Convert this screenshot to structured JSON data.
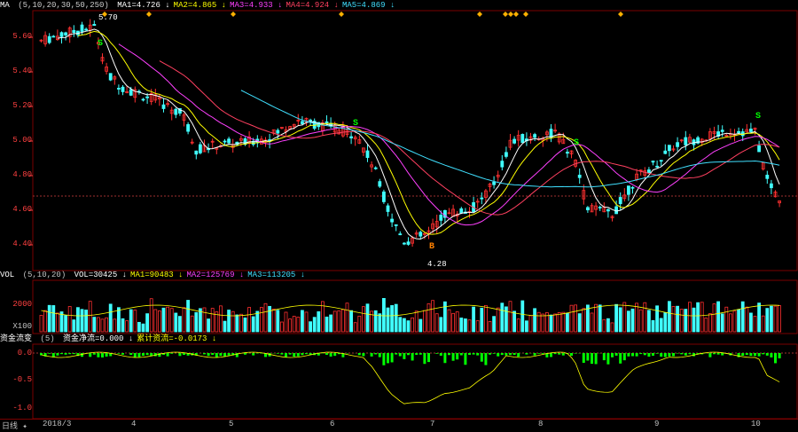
{
  "ma_header": {
    "label": "MA",
    "params": "(5,10,20,30,50,250)",
    "items": [
      {
        "text": "MA1=4.726",
        "color": "#ffffff"
      },
      {
        "text": "MA2=4.865",
        "color": "#ffff00"
      },
      {
        "text": "MA3=4.933",
        "color": "#ff40ff"
      },
      {
        "text": "MA4=4.924",
        "color": "#ff4060"
      },
      {
        "text": "MA5=4.869",
        "color": "#40e0ff"
      }
    ]
  },
  "price_axis": [
    "5.60",
    "5.40",
    "5.20",
    "5.00",
    "4.80",
    "4.60",
    "4.40"
  ],
  "annotations": {
    "high": "5.70",
    "low": "4.28",
    "signal_s": "S",
    "signal_b": "B"
  },
  "vol_header": {
    "label": "VOL",
    "params": "(5,10,20)",
    "items": [
      {
        "text": "VOL=30425",
        "color": "#ffffff"
      },
      {
        "text": "MA1=90483",
        "color": "#ffff00"
      },
      {
        "text": "MA2=125769",
        "color": "#ff40ff"
      },
      {
        "text": "MA3=113205",
        "color": "#40e0ff"
      }
    ]
  },
  "vol_axis": [
    "2000",
    "X100"
  ],
  "fund_header": {
    "label": "资金流变",
    "params": "(5)",
    "items": [
      {
        "text": "资金净流=0.000",
        "color": "#ffffff"
      },
      {
        "text": "累计资流=-0.0173",
        "color": "#ffff00"
      }
    ]
  },
  "fund_axis": [
    "0.0",
    "-0.5",
    "-1.0"
  ],
  "status": {
    "period": "日线",
    "date": "2018/3"
  },
  "x_axis": [
    "4",
    "5",
    "6",
    "7",
    "8",
    "9",
    "10"
  ],
  "colors": {
    "up": "#ff3030",
    "down": "#40ffff",
    "green": "#00ff00",
    "grid": "#7a0000"
  }
}
